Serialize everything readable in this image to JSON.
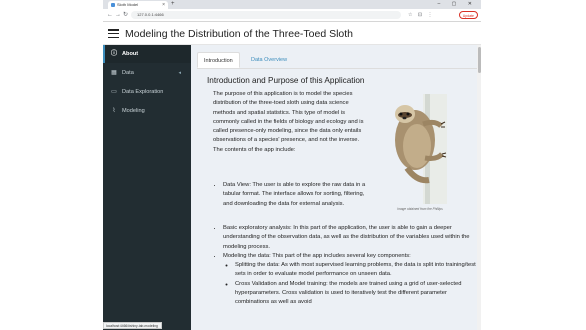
{
  "browser": {
    "tab_title": "Sloth Model",
    "new_tab": "+",
    "window_controls": "–  ▢  ✕",
    "back": "←",
    "forward": "→",
    "reload": "↻",
    "address": "127.0.0.1:4466",
    "toolbar_icons": "☆ ⊡ ⋮",
    "profile": "Update"
  },
  "app": {
    "title": "Modeling the Distribution of the Three-Toed Sloth"
  },
  "sidebar": {
    "items": [
      {
        "label": "About",
        "icon": "info-icon",
        "glyph": "ⓘ"
      },
      {
        "label": "Data",
        "icon": "table-icon",
        "glyph": "▦"
      },
      {
        "label": "Data Exploration",
        "icon": "map-icon",
        "glyph": "▭"
      },
      {
        "label": "Modeling",
        "icon": "chart-line-icon",
        "glyph": "⌇"
      }
    ],
    "caret": "◂"
  },
  "status_url": "localhost:4466/#shiny-tab-modeling",
  "tabs": [
    {
      "label": "Introduction"
    },
    {
      "label": "Data Overview"
    }
  ],
  "content": {
    "heading": "Introduction and Purpose of this Application",
    "intro": "The purpose of this application is to model the species distribution of the three-toed sloth using data science methods and spatial statistics. This type of model is commonly called in the fields of biology and ecology and is called presence-only modeling, since the data only entails observations of a species' presence, and not the inverse. The contents of the app include:",
    "image_caption": "Image obtained from the Phillips",
    "bullets": [
      "Data View: The user is able to explore the raw data in a tabular format. The interface allows for sorting, filtering, and downloading the data for external analysis.",
      "Basic exploratory analysis: In this part of the application, the user is able to gain a deeper understanding of the observation data, as well as the distribution of the variables used within the modeling process.",
      "Modeling the data: This part of the app includes several key components:"
    ],
    "sub_bullets": [
      "Splitting the data: As with most supervised learning problems, the data is split into training/test sets in order to evaluate model performance on unseen data.",
      "Cross Validation and Model training: the models are trained using a grid of user-selected hyperparameters. Cross validation is used to iteratively test the different parameter combinations as well as avoid"
    ]
  }
}
